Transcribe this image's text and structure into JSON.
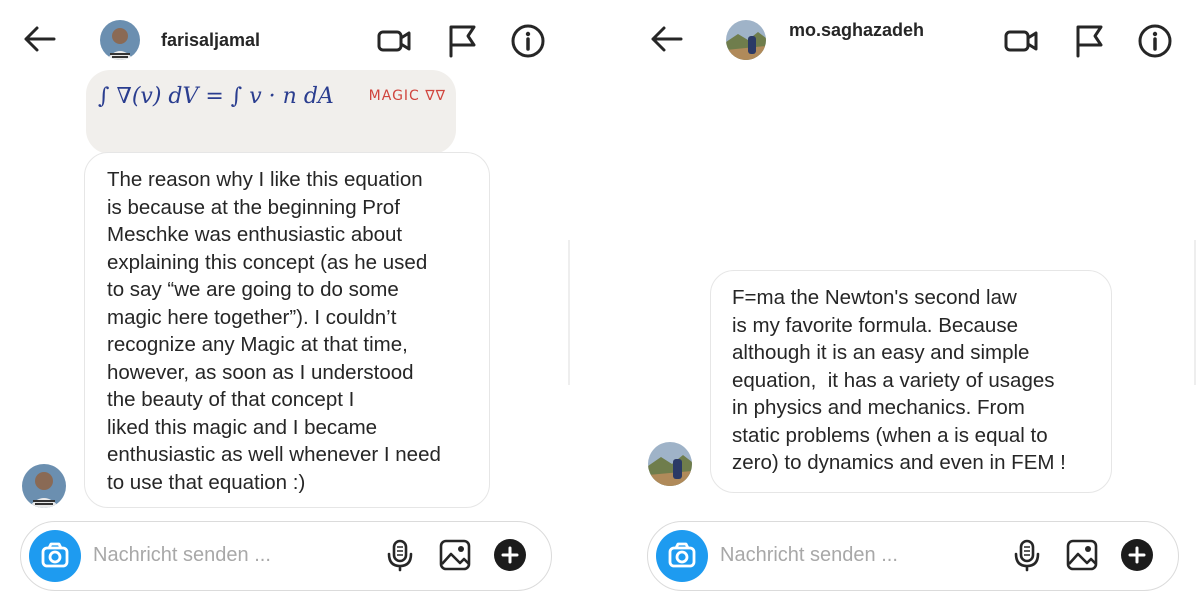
{
  "left": {
    "header": {
      "username": "farisaljamal"
    },
    "attachment": {
      "equation_text": "∫ ∇(v) dV = ∫ v · n dA",
      "annotation": "MAGIC ∇∇"
    },
    "message": {
      "lines": [
        "The reason why I like this equation",
        "is because at the beginning Prof",
        "Meschke was enthusiastic about",
        "explaining this concept (as he used",
        "to say “we are going to do some",
        "magic here together”). I couldn’t",
        "recognize any Magic at that time,",
        "however, as soon as I understood",
        "the beauty of that concept I",
        "liked this magic and I became",
        "enthusiastic as well whenever I need",
        "to use that equation :)"
      ]
    },
    "composer": {
      "placeholder": "Nachricht senden ..."
    }
  },
  "right": {
    "header": {
      "username": "mo.saghazadeh"
    },
    "message": {
      "lines": [
        "F=ma the Newton's second law",
        "is my favorite formula. Because",
        "although it is an easy and simple",
        "equation,  it has a variety of usages",
        "in physics and mechanics. From",
        "static problems (when a is equal to",
        "zero) to dynamics and even in FEM !"
      ]
    },
    "composer": {
      "placeholder": "Nachricht senden ..."
    }
  },
  "icons": {
    "back": "arrow-left-icon",
    "video": "video-camera-icon",
    "flag": "flag-icon",
    "info": "info-icon",
    "camera": "camera-icon",
    "mic": "microphone-icon",
    "gallery": "image-icon",
    "plus": "plus-circle-icon"
  },
  "colors": {
    "accent": "#1e9bf0",
    "text": "#262626",
    "placeholder": "#a8a8a8",
    "border": "#dbdbdb"
  }
}
